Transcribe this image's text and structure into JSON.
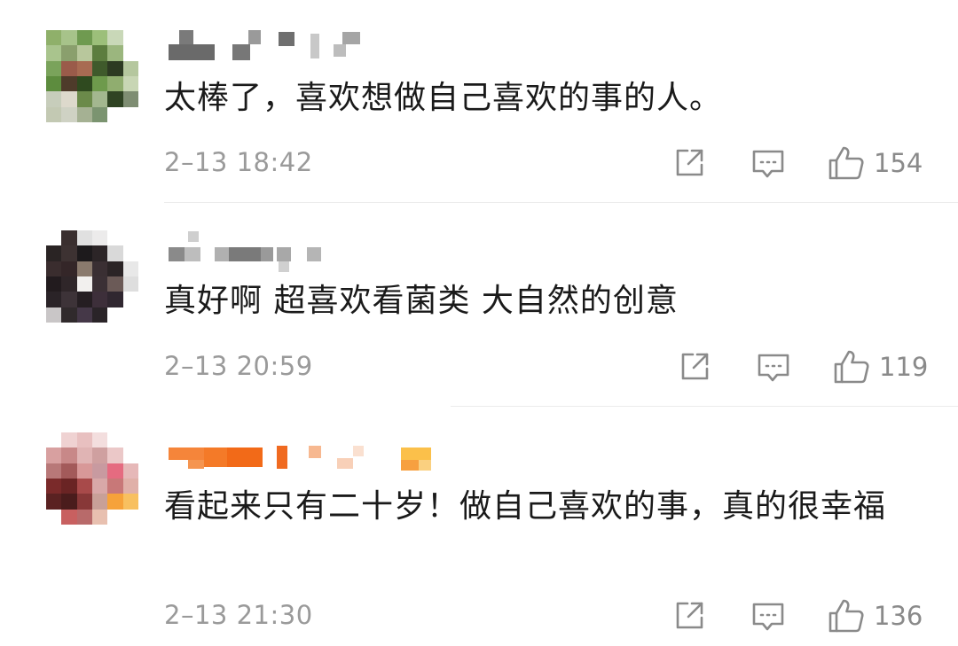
{
  "comments": [
    {
      "text": "太棒了，喜欢想做自己喜欢的事的人。",
      "time": "2–13 18:42",
      "likes": "154"
    },
    {
      "text": "真好啊 超喜欢看菌类 大自然的创意",
      "time": "2–13 20:59",
      "likes": "119"
    },
    {
      "text": "看起来只有二十岁！做自己喜欢的事，真的很幸福",
      "time": "2–13 21:30",
      "likes": "136"
    }
  ],
  "icons": {
    "share": "share-icon",
    "reply": "reply-comment-icon",
    "like": "thumbs-up-icon"
  },
  "colors": {
    "text": "#1a1a1a",
    "meta": "#9a9a9a",
    "icon": "#8a8a8a",
    "divider": "#ececec",
    "username_mosaic_gray": "#6e6e6e",
    "username_mosaic_orange": "#f4792a"
  }
}
